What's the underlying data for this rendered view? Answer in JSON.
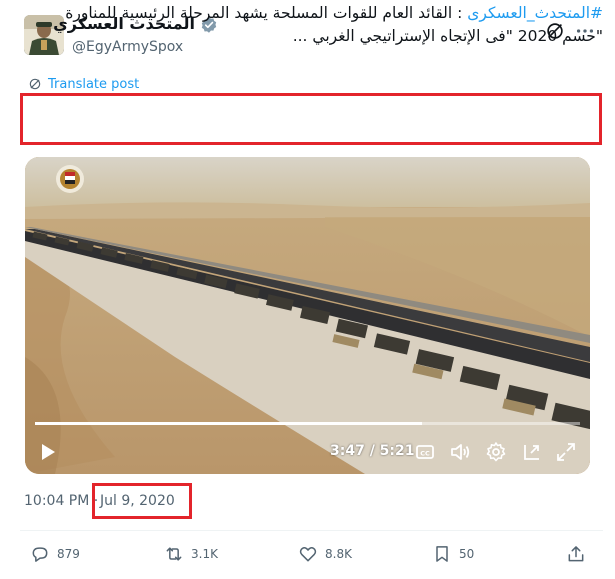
{
  "post": {
    "display_name": "المتحدث العسكري",
    "handle": "@EgyArmySpox",
    "translate_label": "Translate post",
    "hashtag": "#المتحدث_العسكرى",
    "text_line1_rest": " : القائد العام للقوات المسلحة يشهد المرحلة الرئيسية للمناورة",
    "text_line2": "\"حسم 2020 \"فى الإتجاه الإستراتيجي الغربي ...",
    "time": "10:04 PM",
    "separator": "·",
    "date": "Jul 9, 2020"
  },
  "video": {
    "elapsed_remaining": "3:47 / 5:21",
    "progress_fraction": 0.71,
    "controls": [
      "play-icon",
      "closed-captions-icon",
      "volume-icon",
      "settings-icon",
      "picture-in-picture-icon",
      "fullscreen-icon"
    ]
  },
  "actions": {
    "replies": "879",
    "reposts": "3.1K",
    "likes": "8.8K",
    "bookmarks": "50"
  },
  "colors": {
    "accent": "#1d9bf0",
    "highlight_box": "#e3242b",
    "secondary_text": "#536471"
  }
}
